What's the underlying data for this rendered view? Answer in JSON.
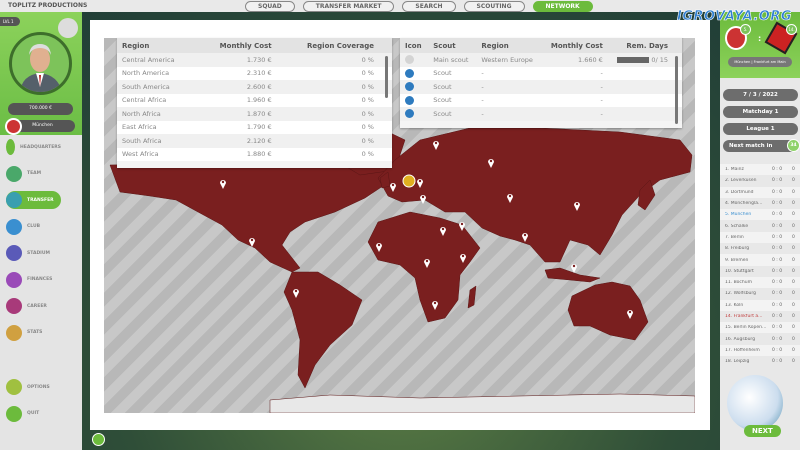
{
  "app": {
    "title": "TOPLITZ PRODUCTIONS",
    "watermark": "IGROVAYA.ORG"
  },
  "nav": [
    "SQUAD",
    "TRANSFER MARKET",
    "SEARCH",
    "SCOUTING",
    "NETWORK"
  ],
  "nav_active": "NETWORK",
  "profile": {
    "level": "LVL 1",
    "money": "700.000 €",
    "club": "München"
  },
  "menu": [
    {
      "label": "HEADQUARTERS",
      "color": "#6cbb3c"
    },
    {
      "label": "TEAM",
      "color": "#4aa86a"
    },
    {
      "label": "TRANSFER",
      "color": "#3a9fb0",
      "active": true
    },
    {
      "label": "CLUB",
      "color": "#3a8fd0"
    },
    {
      "label": "STADIUM",
      "color": "#5a5ab8"
    },
    {
      "label": "FINANCES",
      "color": "#9a4ab8"
    },
    {
      "label": "CAREER",
      "color": "#a83a7a"
    },
    {
      "label": "STATS",
      "color": "#d0a040"
    }
  ],
  "menu_bottom": [
    {
      "label": "OPTIONS",
      "color": "#a0c040"
    },
    {
      "label": "QUIT",
      "color": "#6cbb3c"
    }
  ],
  "regions": {
    "headers": [
      "Region",
      "Monthly Cost",
      "Region Coverage"
    ],
    "rows": [
      [
        "Central America",
        "1.730 €",
        "0 %"
      ],
      [
        "North America",
        "2.310 €",
        "0 %"
      ],
      [
        "South America",
        "2.600 €",
        "0 %"
      ],
      [
        "Central Africa",
        "1.960 €",
        "0 %"
      ],
      [
        "North Africa",
        "1.870 €",
        "0 %"
      ],
      [
        "East Africa",
        "1.790 €",
        "0 %"
      ],
      [
        "South Africa",
        "2.120 €",
        "0 %"
      ],
      [
        "West Africa",
        "1.880 €",
        "0 %"
      ]
    ]
  },
  "scouts": {
    "headers": [
      "Icon",
      "Scout",
      "Region",
      "Monthly Cost",
      "Rem. Days"
    ],
    "rows": [
      {
        "icon": "grey-circle-icon",
        "scout": "Main scout",
        "region": "Western Europe",
        "cost": "1.660 €",
        "days": "0/  15",
        "progress": 0
      },
      {
        "icon": "user-icon",
        "scout": "Scout",
        "region": "-",
        "cost": "-",
        "days": ""
      },
      {
        "icon": "user-icon",
        "scout": "Scout",
        "region": "-",
        "cost": "-",
        "days": ""
      },
      {
        "icon": "user-icon",
        "scout": "Scout",
        "region": "-",
        "cost": "-",
        "days": ""
      },
      {
        "icon": "user-icon",
        "scout": "Scout",
        "region": "-",
        "cost": "-",
        "days": ""
      }
    ]
  },
  "match": {
    "home_rank": "5.",
    "away_rank": "14.",
    "teams": "München  |  Frankfurt am Main",
    "date": "7  /  3  /  2022",
    "matchday": "Matchday 1",
    "league": "League 1",
    "next_label": "Next match in",
    "next_days": "34"
  },
  "table": [
    [
      "1. Mainz",
      "0 : 0",
      "0"
    ],
    [
      "2. Leverkusen",
      "0 : 0",
      "0"
    ],
    [
      "3. Dortmund",
      "0 : 0",
      "0"
    ],
    [
      "4. Mönchengla...",
      "0 : 0",
      "0"
    ],
    [
      "5. München",
      "0 : 0",
      "0"
    ],
    [
      "6. Schalke",
      "0 : 0",
      "0"
    ],
    [
      "7. Berlin",
      "0 : 0",
      "0"
    ],
    [
      "8. Freiburg",
      "0 : 0",
      "0"
    ],
    [
      "9. Bremen",
      "0 : 0",
      "0"
    ],
    [
      "10. Stuttgart",
      "0 : 0",
      "0"
    ],
    [
      "11. Bochum",
      "0 : 0",
      "0"
    ],
    [
      "12. Wolfsburg",
      "0 : 0",
      "0"
    ],
    [
      "13. Köln",
      "0 : 0",
      "0"
    ],
    [
      "14. Frankfurt a...",
      "0 : 0",
      "0"
    ],
    [
      "15. Berlin Köpen...",
      "0 : 0",
      "0"
    ],
    [
      "16. Augsburg",
      "0 : 0",
      "0"
    ],
    [
      "17. Hoffenheim",
      "0 : 0",
      "0"
    ],
    [
      "18. Leipzig",
      "0 : 0",
      "0"
    ]
  ],
  "table_highlight": {
    "own": "5. München",
    "opponent": "14. Frankfurt a..."
  },
  "next_button": "NEXT",
  "colors": {
    "accent": "#6cbb3c",
    "map_land": "#7a1f1f",
    "scout_icon": "#2e7bbf",
    "own_team": "#3a8fd0",
    "opponent": "#c03a3a"
  }
}
